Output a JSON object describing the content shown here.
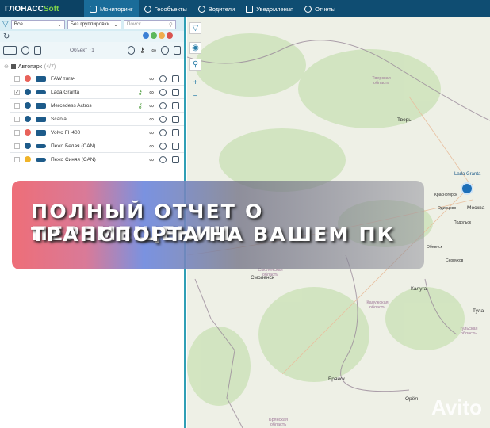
{
  "header": {
    "logo_main": "ГЛОНАСС",
    "logo_accent": "Soft",
    "tabs": [
      {
        "label": "Мониторинг",
        "icon": "monitor-icon",
        "active": true
      },
      {
        "label": "Геообъекты",
        "icon": "geo-icon"
      },
      {
        "label": "Водители",
        "icon": "steering-wheel-icon"
      },
      {
        "label": "Уведомления",
        "icon": "mail-icon"
      },
      {
        "label": "Отчеты",
        "icon": "reports-icon"
      }
    ]
  },
  "filters": {
    "status": "Все",
    "grouping": "Без группировки",
    "search_placeholder": "Поиск"
  },
  "status_dots": [
    "#3a7fd5",
    "#5cb85c",
    "#f0ad4e",
    "#d9534f"
  ],
  "toolbar": {
    "sort_label": "Объект ↑1"
  },
  "group": {
    "name": "Автопарк",
    "count": "(4/7)"
  },
  "vehicles": [
    {
      "name": "FAW тягач",
      "status_color": "#e8625a",
      "type": "truck",
      "checked": false,
      "key": false
    },
    {
      "name": "Lada Granta",
      "status_color": "#1d5b8a",
      "type": "car",
      "checked": true,
      "key": true
    },
    {
      "name": "Mercedess Actros",
      "status_color": "#1d5b8a",
      "type": "truck",
      "checked": false,
      "key": true
    },
    {
      "name": "Scania",
      "status_color": "#1d5b8a",
      "type": "truck",
      "checked": false,
      "key": false
    },
    {
      "name": "Volvo FH400",
      "status_color": "#e8625a",
      "type": "truck",
      "checked": false,
      "key": false
    },
    {
      "name": "Пежо Белая (CAN)",
      "status_color": "#1d5b8a",
      "type": "car",
      "checked": false,
      "key": false
    },
    {
      "name": "Пежо Синяя (CAN)",
      "status_color": "#f0b429",
      "type": "car",
      "checked": false,
      "key": false
    }
  ],
  "map": {
    "cities": [
      "Тверь",
      "Смоленск",
      "Калуга",
      "Брянск",
      "Москва",
      "Красногорск",
      "Одинцово",
      "Обнинск",
      "Серпухов",
      "Тула",
      "Орёл",
      "Подольск"
    ],
    "regions": [
      "Тверская область",
      "Смоленская область",
      "Калужская область",
      "Тульская область",
      "Брянская область"
    ],
    "marker_label": "Lada Granta"
  },
  "banner": {
    "line1": "ПОЛНЫЙ ОТЧЕТ О ПЕРЕМЕЩЕНИИ",
    "line2": "ТРАНСПОРТА НА ВАШЕМ ПК"
  },
  "watermark": "Avito"
}
